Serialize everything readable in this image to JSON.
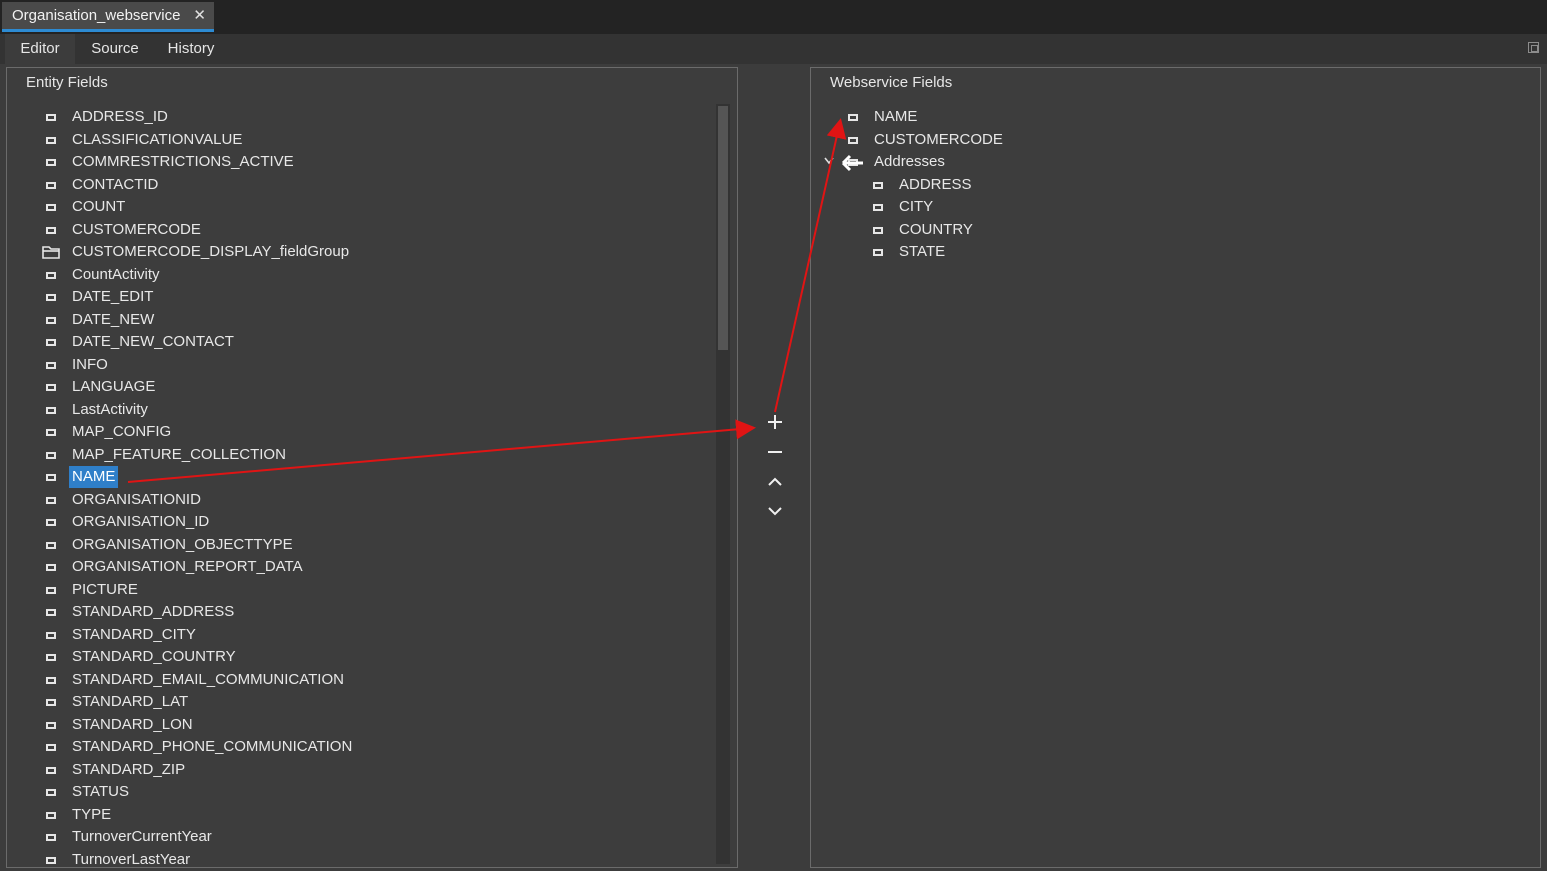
{
  "document_tab": {
    "title": "Organisation_webservice",
    "close_glyph": "✕"
  },
  "view_tabs": [
    {
      "label": "Editor",
      "active": true
    },
    {
      "label": "Source",
      "active": false
    },
    {
      "label": "History",
      "active": false
    }
  ],
  "entity_panel": {
    "title": "Entity Fields",
    "fields": [
      {
        "label": "ADDRESS_ID",
        "icon": "field-icon"
      },
      {
        "label": "CLASSIFICATIONVALUE",
        "icon": "field-icon"
      },
      {
        "label": "COMMRESTRICTIONS_ACTIVE",
        "icon": "field-icon"
      },
      {
        "label": "CONTACTID",
        "icon": "field-icon"
      },
      {
        "label": "COUNT",
        "icon": "field-icon"
      },
      {
        "label": "CUSTOMERCODE",
        "icon": "field-icon"
      },
      {
        "label": "CUSTOMERCODE_DISPLAY_fieldGroup",
        "icon": "folder-icon"
      },
      {
        "label": "CountActivity",
        "icon": "field-icon"
      },
      {
        "label": "DATE_EDIT",
        "icon": "field-icon"
      },
      {
        "label": "DATE_NEW",
        "icon": "field-icon"
      },
      {
        "label": "DATE_NEW_CONTACT",
        "icon": "field-icon"
      },
      {
        "label": "INFO",
        "icon": "field-icon"
      },
      {
        "label": "LANGUAGE",
        "icon": "field-icon"
      },
      {
        "label": "LastActivity",
        "icon": "field-icon"
      },
      {
        "label": "MAP_CONFIG",
        "icon": "field-icon"
      },
      {
        "label": "MAP_FEATURE_COLLECTION",
        "icon": "field-icon"
      },
      {
        "label": "NAME",
        "icon": "field-icon",
        "selected": true
      },
      {
        "label": "ORGANISATIONID",
        "icon": "field-icon"
      },
      {
        "label": "ORGANISATION_ID",
        "icon": "field-icon"
      },
      {
        "label": "ORGANISATION_OBJECTTYPE",
        "icon": "field-icon"
      },
      {
        "label": "ORGANISATION_REPORT_DATA",
        "icon": "field-icon"
      },
      {
        "label": "PICTURE",
        "icon": "field-icon"
      },
      {
        "label": "STANDARD_ADDRESS",
        "icon": "field-icon"
      },
      {
        "label": "STANDARD_CITY",
        "icon": "field-icon"
      },
      {
        "label": "STANDARD_COUNTRY",
        "icon": "field-icon"
      },
      {
        "label": "STANDARD_EMAIL_COMMUNICATION",
        "icon": "field-icon"
      },
      {
        "label": "STANDARD_LAT",
        "icon": "field-icon"
      },
      {
        "label": "STANDARD_LON",
        "icon": "field-icon"
      },
      {
        "label": "STANDARD_PHONE_COMMUNICATION",
        "icon": "field-icon"
      },
      {
        "label": "STANDARD_ZIP",
        "icon": "field-icon"
      },
      {
        "label": "STATUS",
        "icon": "field-icon"
      },
      {
        "label": "TYPE",
        "icon": "field-icon"
      },
      {
        "label": "TurnoverCurrentYear",
        "icon": "field-icon"
      },
      {
        "label": "TurnoverLastYear",
        "icon": "field-icon"
      }
    ]
  },
  "transfer_buttons": [
    {
      "name": "add-field-button",
      "icon": "plus-icon"
    },
    {
      "name": "remove-field-button",
      "icon": "minus-icon"
    },
    {
      "name": "move-up-button",
      "icon": "chevron-up-icon"
    },
    {
      "name": "move-down-button",
      "icon": "chevron-down-icon"
    }
  ],
  "webservice_panel": {
    "title": "Webservice Fields",
    "fields": [
      {
        "label": "NAME",
        "icon": "field-icon",
        "depth": 0
      },
      {
        "label": "CUSTOMERCODE",
        "icon": "field-icon",
        "depth": 0
      },
      {
        "label": "Addresses",
        "icon": "field-icon",
        "depth": 0,
        "expanded": true
      },
      {
        "label": "ADDRESS",
        "icon": "field-icon",
        "depth": 1
      },
      {
        "label": "CITY",
        "icon": "field-icon",
        "depth": 1
      },
      {
        "label": "COUNTRY",
        "icon": "field-icon",
        "depth": 1
      },
      {
        "label": "STATE",
        "icon": "field-icon",
        "depth": 1
      }
    ]
  },
  "annotation_color": "#e01414"
}
